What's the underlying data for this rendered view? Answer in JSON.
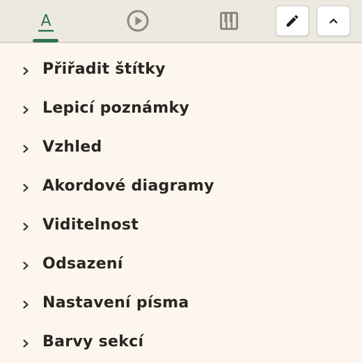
{
  "toolbar": {
    "tabs": [
      {
        "icon": "text-format-icon",
        "glyph": "A",
        "active": true
      },
      {
        "icon": "play-circle-icon",
        "active": false
      },
      {
        "icon": "piano-keys-icon",
        "active": false
      }
    ],
    "edit_icon": "pencil-icon",
    "collapse_icon": "chevron-up-icon",
    "accent_color": "#2e7350"
  },
  "menu": {
    "items": [
      {
        "label": "Přiřadit štítky"
      },
      {
        "label": "Lepicí poznámky"
      },
      {
        "label": "Vzhled"
      },
      {
        "label": "Akordové diagramy"
      },
      {
        "label": "Viditelnost"
      },
      {
        "label": "Odsazení"
      },
      {
        "label": "Nastavení písma"
      },
      {
        "label": "Barvy sekcí"
      }
    ]
  }
}
